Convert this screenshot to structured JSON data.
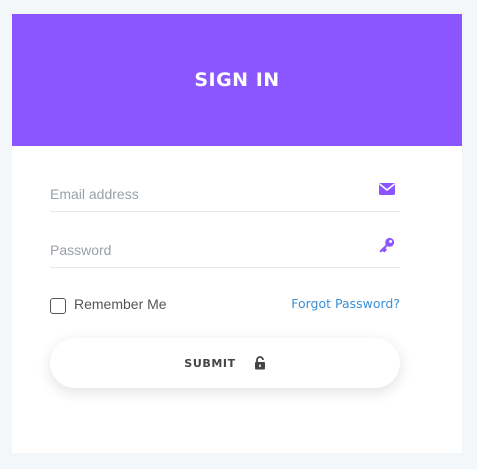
{
  "header": {
    "title": "SIGN IN"
  },
  "form": {
    "email": {
      "placeholder": "Email address",
      "value": "",
      "icon": "envelope-icon"
    },
    "password": {
      "placeholder": "Password",
      "value": "",
      "icon": "key-icon"
    },
    "remember": {
      "label": "Remember Me",
      "checked": false
    },
    "forgot": {
      "label": "Forgot Password?"
    },
    "submit": {
      "label": "SUBMIT",
      "icon": "unlock-icon"
    }
  },
  "colors": {
    "header_bg": "#8b55ff",
    "icon": "#8b55ff",
    "link": "#3a8fd6",
    "page_bg": "#f3f7fa"
  }
}
